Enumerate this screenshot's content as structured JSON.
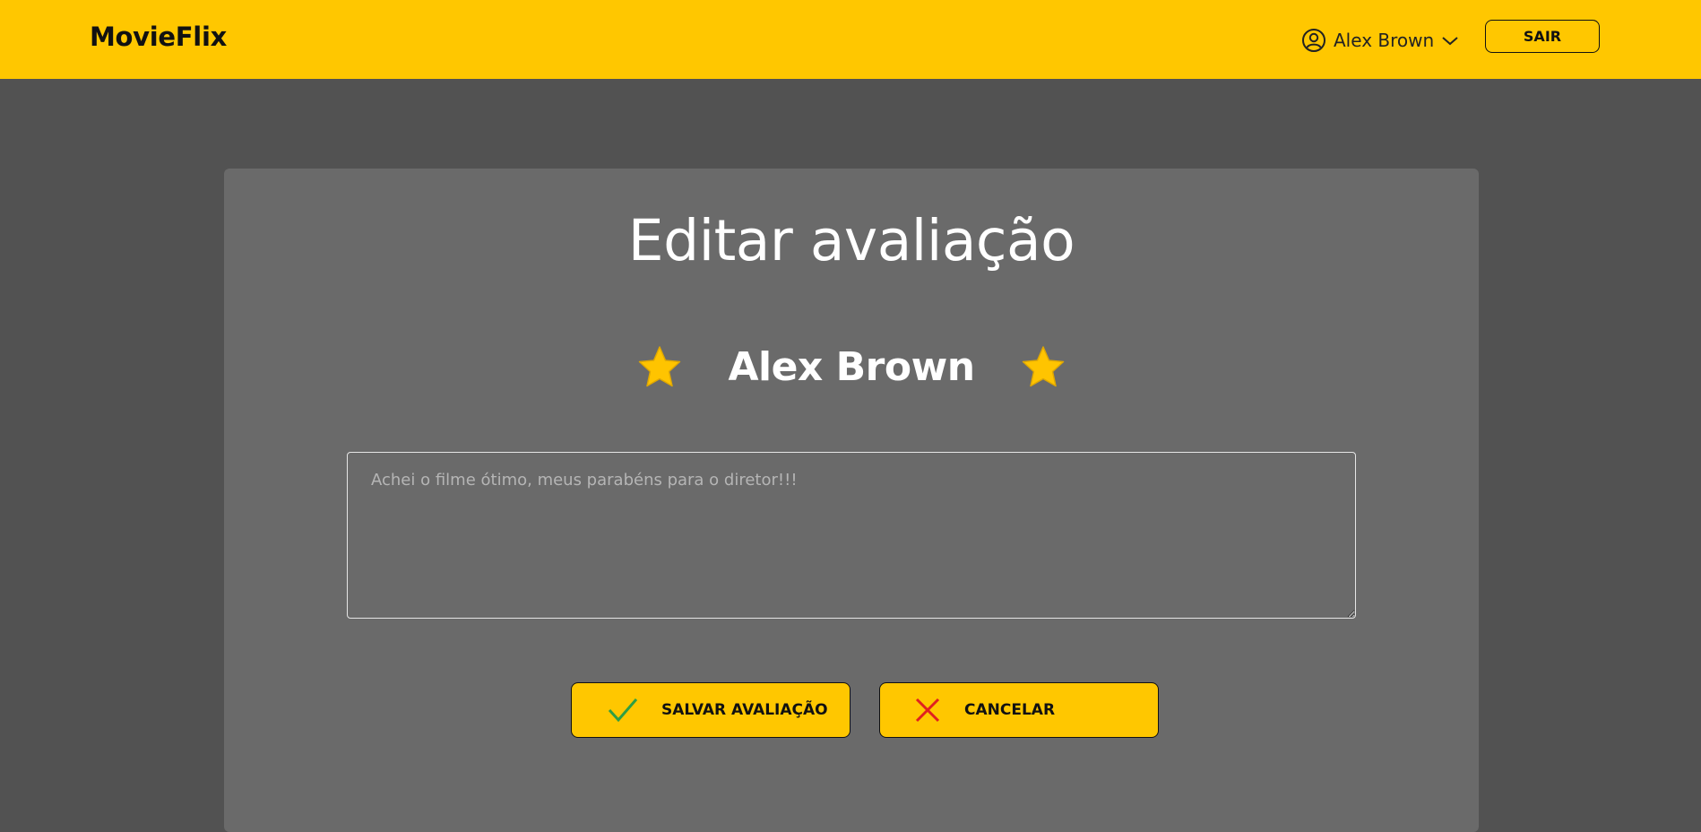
{
  "app": {
    "brand": "MovieFlix"
  },
  "header": {
    "user_name": "Alex Brown",
    "user_icon": "user-circle-icon",
    "dropdown_icon": "chevron-down-icon",
    "logout_label": "SAIR"
  },
  "review_form": {
    "title": "Editar avaliação",
    "reviewer_name": "Alex Brown",
    "star_icon": "star-icon",
    "review_placeholder": "Achei o filme ótimo, meus parabéns para o diretor!!!",
    "review_value": "",
    "save_label": "SALVAR AVALIAÇÃO",
    "save_icon": "check-icon",
    "cancel_label": "CANCELAR",
    "cancel_icon": "close-icon"
  },
  "colors": {
    "primary": "#ffc700",
    "page_background": "#525252",
    "card_background": "#6a6a6a",
    "check": "#2f9e44",
    "cancel_x": "#e02020"
  }
}
